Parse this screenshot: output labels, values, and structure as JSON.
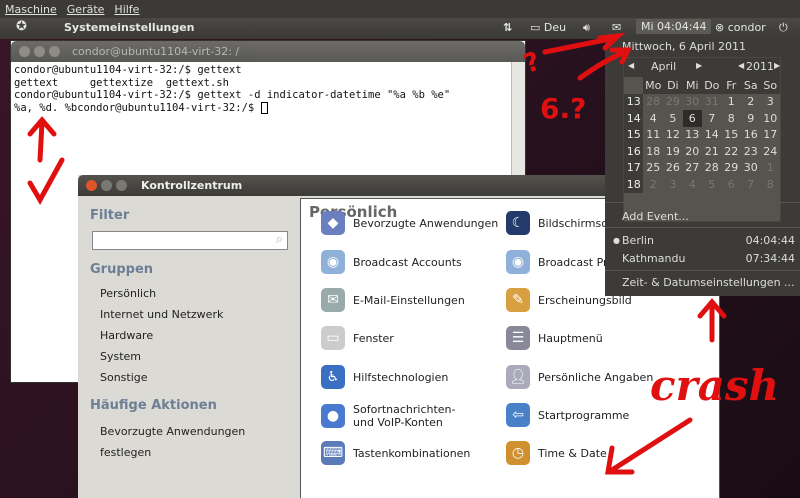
{
  "vb_menu": [
    "Maschine",
    "Geräte",
    "Hilfe"
  ],
  "panel": {
    "app_title": "Systemeinstellungen",
    "keyboard": "Deu",
    "clock": "Mi 04:04:44",
    "user": "condor"
  },
  "terminal": {
    "title": "condor@ubuntu1104-virt-32: /",
    "lines": [
      "condor@ubuntu1104-virt-32:/$ gettext",
      "gettext     gettextize  gettext.sh",
      "condor@ubuntu1104-virt-32:/$ gettext -d indicator-datetime \"%a %b %e\"",
      "%a, %d. %bcondor@ubuntu1104-virt-32:/$ "
    ]
  },
  "control_center": {
    "title": "Kontrollzentrum",
    "filter_label": "Filter",
    "search_value": "",
    "groups_label": "Gruppen",
    "groups": [
      "Persönlich",
      "Internet und Netzwerk",
      "Hardware",
      "System",
      "Sonstige"
    ],
    "actions_label": "Häufige Aktionen",
    "actions": [
      "Bevorzugte Anwendungen festlegen"
    ],
    "section_title": "Persönlich",
    "items_col1": [
      "Bevorzugte Anwendungen",
      "Broadcast Accounts",
      "E-Mail-Einstellungen",
      "Fenster",
      "Hilfstechnologien",
      "Sofortnachrichten- und VoIP-Konten",
      "Tastenkombinationen"
    ],
    "items_col2": [
      "Bildschirmschoner",
      "Broadcast Preferences",
      "Erscheinungsbild",
      "Hauptmenü",
      "Persönliche Angaben",
      "Startprogramme",
      "Time & Date"
    ]
  },
  "calendar": {
    "date_header": "Mittwoch,  6 April 2011",
    "month": "April",
    "year": "2011",
    "weekdays": [
      "Mo",
      "Di",
      "Mi",
      "Do",
      "Fr",
      "Sa",
      "So"
    ],
    "weeks": [
      {
        "wk": "13",
        "days": [
          "28",
          "29",
          "30",
          "31",
          "1",
          "2",
          "3"
        ]
      },
      {
        "wk": "14",
        "days": [
          "4",
          "5",
          "6",
          "7",
          "8",
          "9",
          "10"
        ]
      },
      {
        "wk": "15",
        "days": [
          "11",
          "12",
          "13",
          "14",
          "15",
          "16",
          "17"
        ]
      },
      {
        "wk": "16",
        "days": [
          "18",
          "19",
          "20",
          "21",
          "22",
          "23",
          "24"
        ]
      },
      {
        "wk": "17",
        "days": [
          "25",
          "26",
          "27",
          "28",
          "29",
          "30",
          "1"
        ]
      },
      {
        "wk": "18",
        "days": [
          "2",
          "3",
          "4",
          "5",
          "6",
          "7",
          "8"
        ]
      }
    ],
    "selected_day": "6",
    "add_event": "Add Event...",
    "locations": [
      {
        "city": "Berlin",
        "time": "04:04:44",
        "current": true
      },
      {
        "city": "Kathmandu",
        "time": "07:34:44",
        "current": false
      }
    ],
    "settings": "Zeit- & Datumseinstellungen ..."
  },
  "annotations": {
    "q1": "?",
    "q2": "6.?",
    "crash": "crash"
  }
}
